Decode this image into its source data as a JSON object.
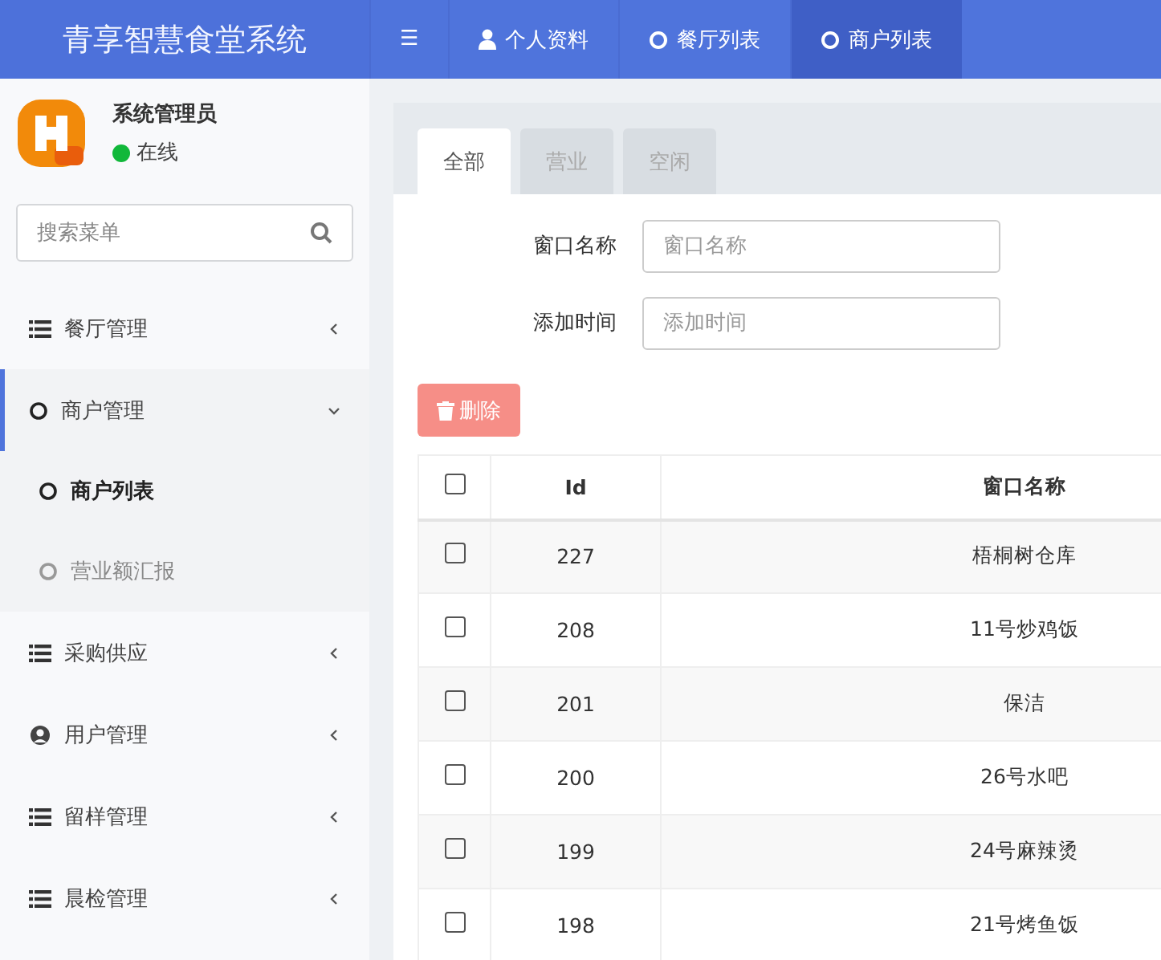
{
  "app_title": "青享智慧食堂系统",
  "top_nav": [
    {
      "kind": "menu",
      "label": "☰",
      "selected": false
    },
    {
      "kind": "user",
      "label": "个人资料",
      "selected": false
    },
    {
      "kind": "circle",
      "label": "餐厅列表",
      "selected": false
    },
    {
      "kind": "circle",
      "label": "商户列表",
      "selected": true
    }
  ],
  "user": {
    "name": "系统管理员",
    "status": "在线"
  },
  "search": {
    "placeholder": "搜索菜单"
  },
  "sidebar": {
    "items": [
      {
        "kind": "list",
        "label": "餐厅管理",
        "expanded": false,
        "selected": false
      },
      {
        "kind": "circle",
        "label": "商户管理",
        "expanded": true,
        "selected": true,
        "children": [
          {
            "label": "商户列表",
            "selected": true
          },
          {
            "label": "营业额汇报",
            "selected": false
          }
        ]
      },
      {
        "kind": "list",
        "label": "采购供应",
        "expanded": false,
        "selected": false
      },
      {
        "kind": "user",
        "label": "用户管理",
        "expanded": false,
        "selected": false
      },
      {
        "kind": "list",
        "label": "留样管理",
        "expanded": false,
        "selected": false
      },
      {
        "kind": "list",
        "label": "晨检管理",
        "expanded": false,
        "selected": false
      }
    ]
  },
  "tabs": [
    {
      "label": "全部",
      "selected": true
    },
    {
      "label": "营业",
      "selected": false
    },
    {
      "label": "空闲",
      "selected": false
    }
  ],
  "filters": [
    {
      "label": "窗口名称",
      "placeholder": "窗口名称"
    },
    {
      "label": "添加时间",
      "placeholder": "添加时间"
    }
  ],
  "delete_button": "删除",
  "table": {
    "header_checked": false,
    "columns": [
      "Id",
      "窗口名称"
    ],
    "rows": [
      {
        "checked": false,
        "cells": [
          "227",
          "梧桐树仓库"
        ]
      },
      {
        "checked": false,
        "cells": [
          "208",
          "11号炒鸡饭"
        ]
      },
      {
        "checked": false,
        "cells": [
          "201",
          "保洁"
        ]
      },
      {
        "checked": false,
        "cells": [
          "200",
          "26号水吧"
        ]
      },
      {
        "checked": false,
        "cells": [
          "199",
          "24号麻辣烫"
        ]
      },
      {
        "checked": false,
        "cells": [
          "198",
          "21号烤鱼饭"
        ]
      }
    ]
  }
}
